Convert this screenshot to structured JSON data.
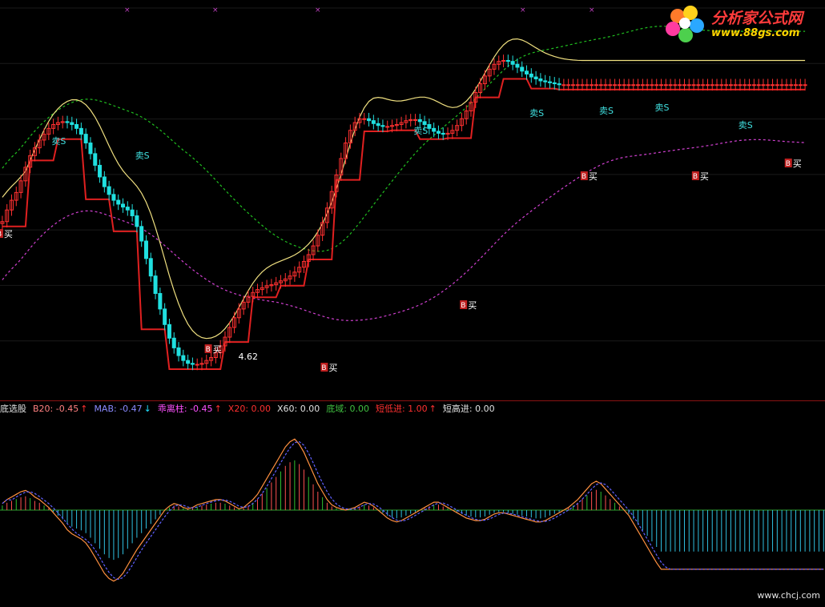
{
  "logo": {
    "title": "分析家公式网",
    "url": "www.88gs.com"
  },
  "indicator_bar": {
    "items": [
      {
        "label": "底选股",
        "value": "",
        "color": "#e0e0e0",
        "arrow": ""
      },
      {
        "label": "B20:",
        "value": "-0.45",
        "color": "#ff8080",
        "arrow": "↑",
        "arrow_color": "#ff3030"
      },
      {
        "label": "MAB:",
        "value": "-0.47",
        "color": "#8a8aff",
        "arrow": "↓",
        "arrow_color": "#20e0ff"
      },
      {
        "label": "乖离柱:",
        "value": "-0.45",
        "color": "#ff50ff",
        "arrow": "↑",
        "arrow_color": "#ff3030"
      },
      {
        "label": "X20:",
        "value": "0.00",
        "color": "#ff3030",
        "arrow": ""
      },
      {
        "label": "X60:",
        "value": "0.00",
        "color": "#e0e0e0",
        "arrow": ""
      },
      {
        "label": "底域:",
        "value": "0.00",
        "color": "#40c040",
        "arrow": ""
      },
      {
        "label": "短低进:",
        "value": "1.00",
        "color": "#ff3030",
        "arrow": "↑",
        "arrow_color": "#ff3030"
      },
      {
        "label": "短高进:",
        "value": "0.00",
        "color": "#e0e0e0",
        "arrow": ""
      }
    ]
  },
  "annotations": {
    "sell": "卖S",
    "buy": "买",
    "buy_marker": "B",
    "low_price": "4.62"
  },
  "watermark": "www.chcj.com",
  "colors": {
    "up": "#ff3030",
    "down": "#20e0e0",
    "pink": "#ff00ff",
    "blue": "#2040ff",
    "support_line": "#e02020",
    "resistance_line": "#f0e080",
    "ma_green": "#20c020",
    "ma_magenta": "#d040d0",
    "dif": "#ff9040",
    "dea": "#6060ff"
  },
  "chart_data": [
    {
      "type": "candlestick",
      "x": [
        1,
        2,
        3,
        4,
        5,
        6,
        7,
        8,
        9,
        10,
        11,
        12,
        13,
        14,
        15,
        16,
        17,
        18,
        19,
        20,
        21,
        22,
        23,
        24,
        25,
        26,
        27,
        28,
        29,
        30,
        31,
        32,
        33,
        34,
        35,
        36,
        37,
        38,
        39,
        40,
        41,
        42,
        43,
        44,
        45,
        46,
        47,
        48,
        49,
        50,
        51,
        52,
        53,
        54,
        55,
        56,
        57,
        58,
        59,
        60,
        61,
        62,
        63,
        64,
        65,
        66,
        67,
        68,
        69,
        70,
        71,
        72,
        73,
        74,
        75,
        76,
        77,
        78,
        79,
        80,
        81,
        82,
        83,
        84,
        85,
        86,
        87,
        88,
        89,
        90,
        91,
        92,
        93,
        94,
        95,
        96,
        97,
        98,
        99,
        100,
        101,
        102,
        103,
        104,
        105,
        106,
        107,
        108,
        109,
        110,
        111,
        112,
        113,
        114,
        115,
        116,
        117,
        118,
        119,
        120,
        121,
        122,
        123,
        124,
        125,
        126,
        127,
        128,
        129,
        130,
        131,
        132,
        133,
        134,
        135,
        136,
        137,
        138,
        139,
        140,
        141,
        142,
        143,
        144,
        145,
        146,
        147,
        148,
        149,
        150,
        151,
        152,
        153,
        154,
        155,
        156,
        157,
        158,
        159,
        160,
        161,
        162,
        163,
        164,
        165,
        166,
        167,
        168,
        169,
        170,
        171,
        172,
        173,
        174,
        175,
        176,
        177,
        178,
        179,
        180
      ],
      "close": [
        6.1,
        6.22,
        6.32,
        6.4,
        6.52,
        6.66,
        6.78,
        6.86,
        6.94,
        7.0,
        7.06,
        7.1,
        7.12,
        7.13,
        7.12,
        7.1,
        7.06,
        7.0,
        6.91,
        6.8,
        6.68,
        6.56,
        6.46,
        6.38,
        6.32,
        6.28,
        6.25,
        6.22,
        6.16,
        6.05,
        5.9,
        5.72,
        5.54,
        5.36,
        5.2,
        5.04,
        4.9,
        4.8,
        4.72,
        4.67,
        4.64,
        4.63,
        4.63,
        4.64,
        4.67,
        4.7,
        4.75,
        4.82,
        4.91,
        5.01,
        5.11,
        5.2,
        5.27,
        5.33,
        5.37,
        5.4,
        5.42,
        5.44,
        5.45,
        5.47,
        5.49,
        5.51,
        5.54,
        5.58,
        5.63,
        5.69,
        5.76,
        5.85,
        5.96,
        6.09,
        6.24,
        6.41,
        6.58,
        6.75,
        6.91,
        7.04,
        7.12,
        7.16,
        7.16,
        7.14,
        7.11,
        7.09,
        7.08,
        7.08,
        7.09,
        7.1,
        7.12,
        7.14,
        7.15,
        7.15,
        7.13,
        7.1,
        7.06,
        7.03,
        7.01,
        7.0,
        7.01,
        7.04,
        7.09,
        7.16,
        7.24,
        7.33,
        7.43,
        7.52,
        7.6,
        7.67,
        7.72,
        7.75,
        7.76,
        7.75,
        7.72,
        7.69,
        7.65,
        7.62,
        7.59,
        7.57,
        7.55,
        7.54,
        7.53,
        7.52,
        7.51,
        7.51,
        7.51,
        7.51,
        7.51,
        7.51,
        7.51,
        7.51,
        7.51,
        7.51,
        7.51,
        7.51,
        7.51,
        7.51,
        7.51,
        7.51,
        7.51,
        7.51,
        7.51,
        7.51,
        7.51,
        7.51,
        7.51,
        7.51,
        7.51,
        7.51,
        7.51,
        7.51,
        7.51,
        7.51,
        7.51,
        7.51,
        7.51,
        7.51,
        7.51,
        7.51,
        7.51,
        7.51,
        7.51,
        7.51,
        7.51,
        7.51,
        7.51,
        7.51,
        7.51,
        7.51,
        7.51,
        7.51,
        7.51,
        7.51,
        7.51,
        7.51,
        7.51,
        7.51
      ],
      "ylim": [
        4.3,
        8.3
      ]
    },
    {
      "type": "line",
      "series": [
        {
          "values": [
            0.05,
            0.08,
            0.1,
            0.12,
            0.14,
            0.15,
            0.13,
            0.1,
            0.08,
            0.05,
            0.02,
            -0.02,
            -0.06,
            -0.1,
            -0.15,
            -0.18,
            -0.2,
            -0.22,
            -0.25,
            -0.3,
            -0.36,
            -0.42,
            -0.48,
            -0.52,
            -0.54,
            -0.52,
            -0.48,
            -0.42,
            -0.36,
            -0.3,
            -0.25,
            -0.2,
            -0.15,
            -0.1,
            -0.05,
            0.0,
            0.03,
            0.05,
            0.04,
            0.02,
            0.01,
            0.02,
            0.04,
            0.05,
            0.06,
            0.07,
            0.08,
            0.08,
            0.07,
            0.05,
            0.03,
            0.01,
            0.02,
            0.05,
            0.08,
            0.12,
            0.18,
            0.24,
            0.3,
            0.36,
            0.42,
            0.48,
            0.52,
            0.54,
            0.5,
            0.44,
            0.36,
            0.28,
            0.2,
            0.14,
            0.08,
            0.04,
            0.02,
            0.01,
            0.0,
            0.01,
            0.02,
            0.04,
            0.06,
            0.05,
            0.03,
            0.0,
            -0.03,
            -0.06,
            -0.08,
            -0.09,
            -0.08,
            -0.06,
            -0.04,
            -0.02,
            0.0,
            0.02,
            0.04,
            0.06,
            0.06,
            0.04,
            0.02,
            0.0,
            -0.02,
            -0.04,
            -0.06,
            -0.07,
            -0.08,
            -0.08,
            -0.07,
            -0.05,
            -0.03,
            -0.02,
            -0.02,
            -0.03,
            -0.04,
            -0.05,
            -0.06,
            -0.07,
            -0.08,
            -0.09,
            -0.09,
            -0.08,
            -0.06,
            -0.04,
            -0.02,
            0.0,
            0.02,
            0.05,
            0.08,
            0.12,
            0.16,
            0.2,
            0.22,
            0.2,
            0.16,
            0.12,
            0.08,
            0.04,
            0.0,
            -0.04,
            -0.1,
            -0.16,
            -0.22,
            -0.28,
            -0.34,
            -0.4,
            -0.45,
            -0.45,
            -0.45,
            -0.45,
            -0.45,
            -0.45,
            -0.45,
            -0.45,
            -0.45,
            -0.45,
            -0.45,
            -0.45,
            -0.45,
            -0.45,
            -0.45,
            -0.45,
            -0.45,
            -0.45,
            -0.45,
            -0.45,
            -0.45,
            -0.45,
            -0.45,
            -0.45,
            -0.45,
            -0.45,
            -0.45,
            -0.45,
            -0.45,
            -0.45,
            -0.45,
            -0.45,
            -0.45,
            -0.45,
            -0.45,
            -0.45
          ]
        }
      ],
      "ylim": [
        -0.7,
        0.7
      ]
    }
  ]
}
